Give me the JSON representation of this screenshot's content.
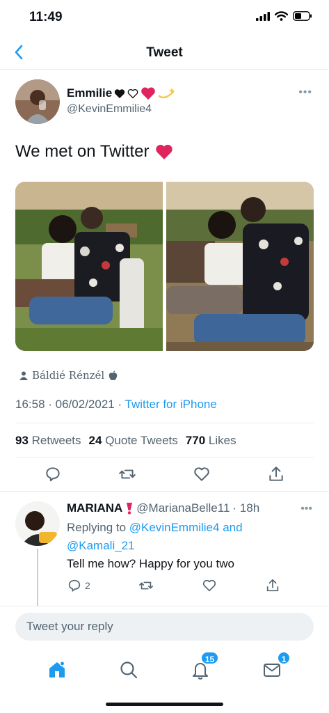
{
  "status_bar": {
    "time": "11:49"
  },
  "nav": {
    "title": "Tweet"
  },
  "tweet": {
    "author_name": "Emmilie",
    "author_handle": "@KevinEmmilie4",
    "text": "We met on Twitter",
    "tag_user": "Báldié Rénzél",
    "timestamp": "16:58 · 06/02/2021 · ",
    "source": "Twitter for iPhone",
    "retweets_count": "93",
    "retweets_label": "Retweets",
    "quote_count": "24",
    "quote_label": "Quote Tweets",
    "likes_count": "770",
    "likes_label": "Likes"
  },
  "reply": {
    "author_name": "MARIANA",
    "author_handle": "@MarianaBelle11",
    "time": "· 18h",
    "replying_prefix": "Replying to ",
    "mention_1": "@KevinEmmilie4",
    "and_word": " and",
    "mention_2": "@Kamali_21",
    "text": "Tell me how? Happy for you two",
    "reply_count": "2"
  },
  "composer": {
    "placeholder": "Tweet your reply"
  },
  "tabbar": {
    "notifications_badge": "15",
    "messages_badge": "1"
  },
  "colors": {
    "accent": "#1d9bf0",
    "heart_red": "#e0245e"
  }
}
